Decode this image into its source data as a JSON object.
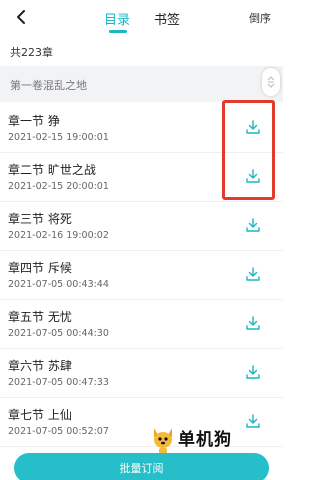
{
  "header": {
    "tabs": [
      {
        "label": "目录",
        "active": true
      },
      {
        "label": "书签",
        "active": false
      }
    ],
    "sort_label": "倒序"
  },
  "summary": {
    "count_text": "共223章"
  },
  "volume": {
    "title": "第一卷混乱之地"
  },
  "chapters": [
    {
      "title": "章一节 狰",
      "time": "2021-02-15 19:00:01"
    },
    {
      "title": "章二节 旷世之战",
      "time": "2021-02-15 20:00:01"
    },
    {
      "title": "章三节 将死",
      "time": "2021-02-16 19:00:02"
    },
    {
      "title": "章四节 斥候",
      "time": "2021-07-05 00:43:44"
    },
    {
      "title": "章五节 无忧",
      "time": "2021-07-05 00:44:30"
    },
    {
      "title": "章六节 苏肆",
      "time": "2021-07-05 00:47:33"
    },
    {
      "title": "章七节 上仙",
      "time": "2021-07-05 00:52:07"
    }
  ],
  "footer": {
    "batch_label": "批量订阅"
  },
  "watermark": {
    "text": "单机狗"
  },
  "colors": {
    "accent": "#1ab7c4",
    "highlight": "#e23b2e",
    "button": "#26bfc9"
  },
  "icons": {
    "back": "chevron-left-icon",
    "download": "download-icon",
    "scroll": "scroll-handle-icon"
  }
}
